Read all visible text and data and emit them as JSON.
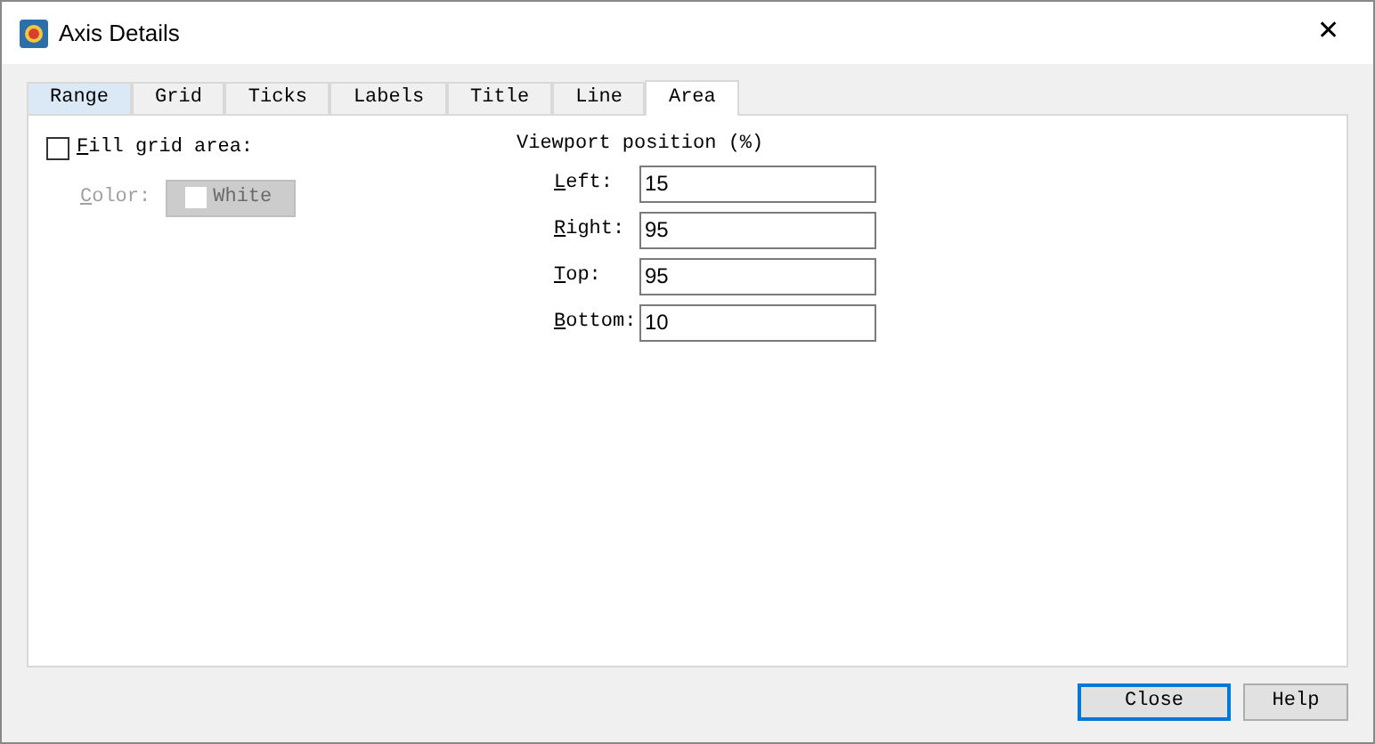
{
  "window": {
    "title": "Axis Details",
    "close": "✕"
  },
  "tabs": [
    {
      "label": "Range",
      "selected": false
    },
    {
      "label": "Grid",
      "selected": false
    },
    {
      "label": "Ticks",
      "selected": false
    },
    {
      "label": "Labels",
      "selected": false
    },
    {
      "label": "Title",
      "selected": false
    },
    {
      "label": "Line",
      "selected": false
    },
    {
      "label": "Area",
      "selected": true
    }
  ],
  "fill": {
    "label": "Fill grid area:",
    "underlined": true,
    "checked": false
  },
  "color": {
    "label": "Color:",
    "underlined": true,
    "value": "White",
    "disabled": true
  },
  "viewport": {
    "title": "Viewport position (%)",
    "fields": [
      {
        "label": "Left:",
        "value": "15",
        "underlined": true
      },
      {
        "label": "Right:",
        "value": "95",
        "underlined": true
      },
      {
        "label": "Top:",
        "value": "95",
        "underlined": true
      },
      {
        "label": "Bottom:",
        "value": "10",
        "underlined": true
      }
    ]
  },
  "buttons": [
    {
      "label": "Close",
      "default": true
    },
    {
      "label": "Help",
      "default": false
    }
  ]
}
